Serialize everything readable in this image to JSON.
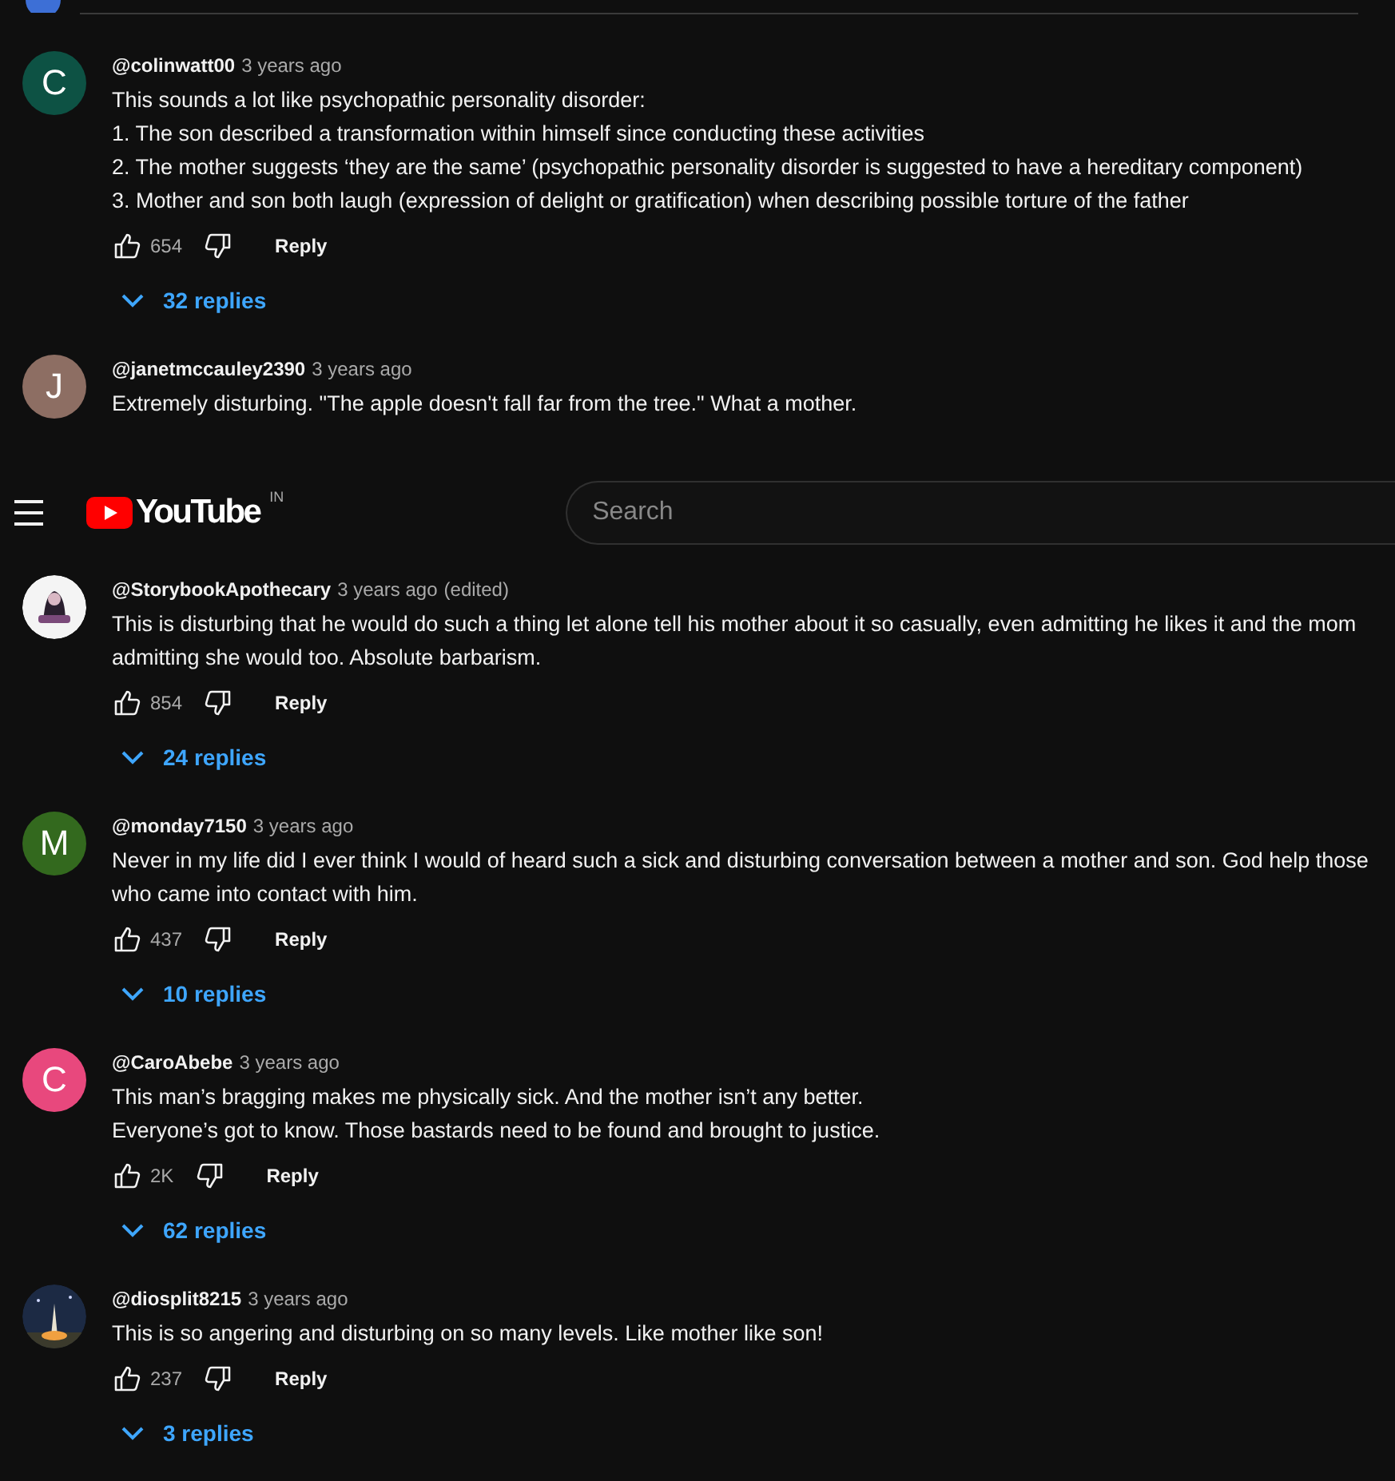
{
  "top_pane": {
    "comments": [
      {
        "avatar": {
          "kind": "letter",
          "letter": "C",
          "color": "#0d5244"
        },
        "author": "@colinwatt00",
        "time": "3 years ago",
        "lines": [
          "This sounds a lot like psychopathic personality disorder:",
          "1. The son described a transformation within himself since conducting these activities",
          "2. The mother suggests ‘they are the same’ (psychopathic personality disorder is suggested to have a hereditary component)",
          "3.  Mother and son both laugh (expression of delight or gratification) when describing possible torture of the father"
        ],
        "likes": "654",
        "reply": "Reply",
        "replies": "32 replies"
      },
      {
        "avatar": {
          "kind": "letter",
          "letter": "J",
          "color": "#8d6e63"
        },
        "author": "@janetmccauley2390",
        "time": "3 years ago",
        "lines": [
          "Extremely disturbing.  \"The apple doesn't fall far from the tree.\"  What a mother."
        ]
      }
    ]
  },
  "header": {
    "logo": "YouTube",
    "country": "IN",
    "search": {
      "placeholder": "Search"
    }
  },
  "comments": [
    {
      "avatar": {
        "kind": "picture"
      },
      "author": "@StorybookApothecary",
      "time": "3 years ago",
      "edited": "(edited)",
      "lines": [
        "This is disturbing that he would do such a thing let alone tell his mother about it so casually, even admitting he likes it and the mom admitting she would too. Absolute barbarism."
      ],
      "likes": "854",
      "reply": "Reply",
      "replies": "24 replies"
    },
    {
      "avatar": {
        "kind": "letter",
        "letter": "M",
        "color": "#33691e"
      },
      "author": "@monday7150",
      "time": "3 years ago",
      "lines": [
        "Never in my life did I ever think I would of heard such a sick and disturbing conversation between a mother and son. God help those who came into contact with him."
      ],
      "likes": "437",
      "reply": "Reply",
      "replies": "10 replies"
    },
    {
      "avatar": {
        "kind": "letter",
        "letter": "C",
        "color": "#e8487d"
      },
      "author": "@CaroAbebe",
      "time": "3 years ago",
      "lines": [
        "This man’s bragging makes me physically sick. And the mother isn’t any better.",
        "Everyone’s got to know. Those bastards need to be found and brought to justice."
      ],
      "likes": "2K",
      "reply": "Reply",
      "replies": "62 replies"
    },
    {
      "avatar": {
        "kind": "picture"
      },
      "author": "@diosplit8215",
      "time": "3 years ago",
      "lines": [
        "This is so angering and disturbing on so many levels. Like mother like son!"
      ],
      "likes": "237",
      "reply": "Reply",
      "replies": "3 replies"
    }
  ]
}
